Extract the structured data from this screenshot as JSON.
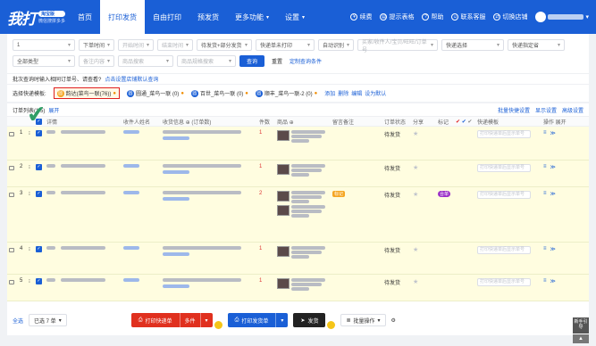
{
  "header": {
    "logo_text": "我打",
    "logo_badge": "淘宝版",
    "logo_sub": "微信搜拼多多",
    "nav": [
      {
        "label": "首页",
        "caret": false
      },
      {
        "label": "打印发货",
        "caret": false,
        "active": true
      },
      {
        "label": "自由打印",
        "caret": false
      },
      {
        "label": "预发货",
        "caret": false
      },
      {
        "label": "更多功能",
        "caret": true
      },
      {
        "label": "设置",
        "caret": true
      }
    ],
    "right": [
      "续费",
      "提示表格",
      "帮助",
      "联系客服",
      "切换店铺"
    ]
  },
  "filters": {
    "row1": [
      {
        "value": "1",
        "ph": false,
        "w": 70
      },
      {
        "value": "下单时间",
        "ph": false,
        "w": 40
      },
      {
        "value": "开始时间",
        "ph": true,
        "w": 40
      },
      {
        "value": "结束时间",
        "ph": true,
        "w": 40
      },
      {
        "value": "待发货+部分发货",
        "ph": false,
        "w": 62
      },
      {
        "value": "快递单未打印",
        "ph": false,
        "w": 66
      },
      {
        "value": "自动识别",
        "ph": false,
        "w": 40
      },
      {
        "value": "买家/收件人/宝贝/旺旺/订单号",
        "ph": true,
        "w": 90
      },
      {
        "value": "快递选择",
        "ph": false,
        "w": 70
      },
      {
        "value": "快递指定省",
        "ph": false,
        "w": 64
      }
    ],
    "row2": [
      {
        "value": "全部类型",
        "ph": false,
        "w": 70
      },
      {
        "value": "备注内容",
        "ph": true,
        "w": 40
      },
      {
        "value": "商品搜索",
        "ph": true,
        "w": 62
      },
      {
        "value": "商品规格搜索",
        "ph": true,
        "w": 66
      }
    ],
    "search_btn": "查询",
    "reset_btn": "重置",
    "custom_link": "定制查询条件"
  },
  "tip": {
    "text": "批次查询时输入相同订单号、请查看?",
    "link": "点击设置店铺默认查询"
  },
  "templates": {
    "label": "选择快递模板:",
    "items": [
      {
        "label": "韵达(菜鸟一联(76))",
        "selected": true
      },
      {
        "label": "圆通_菜鸟一联 (0)",
        "selected": false
      },
      {
        "label": "百世_菜鸟一联 (0)",
        "selected": false
      },
      {
        "label": "顺丰_菜鸟一联-2 (0)",
        "selected": false
      }
    ],
    "actions": [
      "添加",
      "删除",
      "编辑",
      "设为默认"
    ]
  },
  "table": {
    "top_left": "订单列表(1/5)",
    "top_left_link": "展开",
    "top_right": [
      "批量快捷设置",
      "显示设置",
      "高级设置"
    ],
    "headers": [
      "",
      "",
      "",
      "",
      "详情",
      "收件人姓名",
      "收货信息 ⊕ (订单数)",
      "件数",
      "商品 ⊕",
      "",
      "留言备注",
      "订单状态",
      "分享",
      "标记",
      "",
      "快递模板",
      "操作 展开"
    ],
    "rows": [
      {
        "num": "1",
        "count": "1",
        "status": "待发货",
        "extra": "",
        "tag": ""
      },
      {
        "num": "2",
        "count": "1",
        "status": "待发货",
        "extra": "",
        "tag": ""
      },
      {
        "num": "3",
        "count": "2",
        "status": "待发货",
        "extra": "标记",
        "tag": "合单"
      },
      {
        "num": "4",
        "count": "1",
        "status": "待发货",
        "extra": "",
        "tag": ""
      },
      {
        "num": "5",
        "count": "1",
        "status": "待发货",
        "extra": "",
        "tag": ""
      }
    ],
    "track_placeholder": "打印快递单后显示单号",
    "op_expand": "≡",
    "op_more": "≫"
  },
  "bottom": {
    "select_all": "全选",
    "selected_count": "已选 7 单",
    "print_express": "打印快递单",
    "print_express_side": "多件",
    "print_invoice": "打印发货单",
    "ship": "发货",
    "batch": "批量操作",
    "help": "新手引导"
  }
}
